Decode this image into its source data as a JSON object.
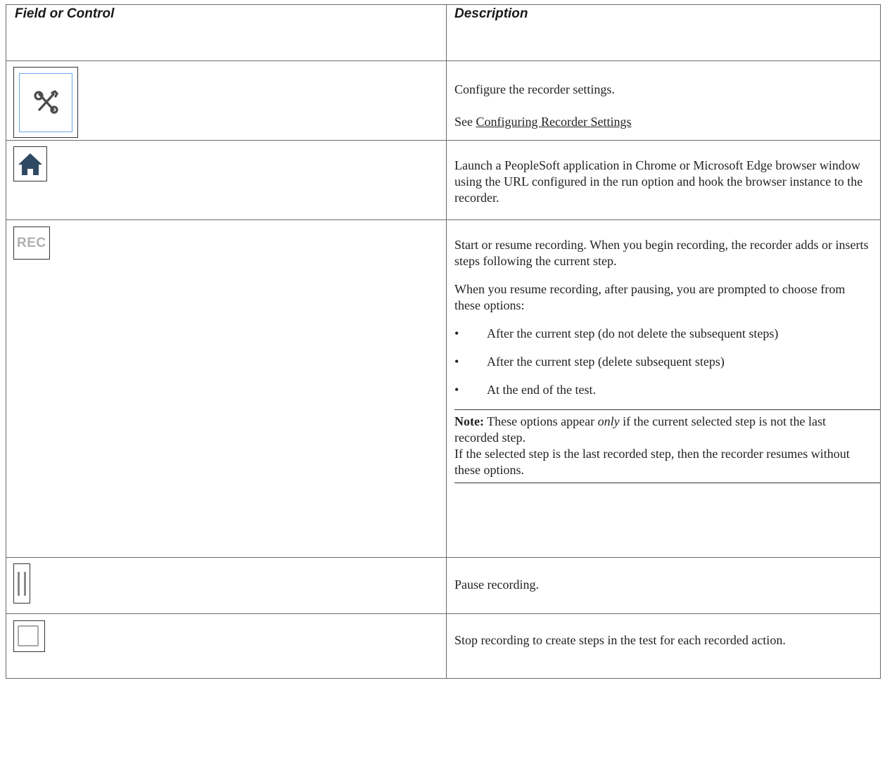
{
  "table": {
    "headers": {
      "field": "Field or Control",
      "description": "Description"
    },
    "rows": [
      {
        "icon": "recorder-settings-icon",
        "desc_text": "Configure the recorder settings.",
        "see_prefix": "See ",
        "see_link": "Configuring Recorder Settings"
      },
      {
        "icon": "home-icon",
        "desc_text": "Launch a PeopleSoft application in Chrome or Microsoft Edge browser window using the URL configured in the run option and hook the browser instance to the recorder."
      },
      {
        "icon": "rec-icon",
        "icon_text": "REC",
        "desc_text": "Start or resume recording. When you begin recording, the recorder adds or inserts steps following the current step.",
        "desc_text2": "When you resume recording, after pausing, you are prompted to choose from these options:",
        "bullet_char": "•",
        "bullets": [
          "After the current step (do not delete the subsequent steps)",
          "After the current step (delete subsequent steps)",
          "At the end of the test."
        ],
        "note": {
          "label": "Note:",
          "part1": " These options appear ",
          "emph": "only",
          "part2": " if the current selected step is not the last recorded step.",
          "line2": "If the selected step is the last recorded step, then the recorder resumes without these options."
        }
      },
      {
        "icon": "pause-icon",
        "desc_text": "Pause recording."
      },
      {
        "icon": "stop-icon",
        "desc_text": "Stop recording to create steps in the test for each recorded action."
      }
    ]
  },
  "colors": {
    "home_icon": "#2f4a63",
    "rec_text": "#b0b0b0",
    "settings_frame": "#6aa6e8",
    "pause_bar": "#8a8a8a"
  }
}
